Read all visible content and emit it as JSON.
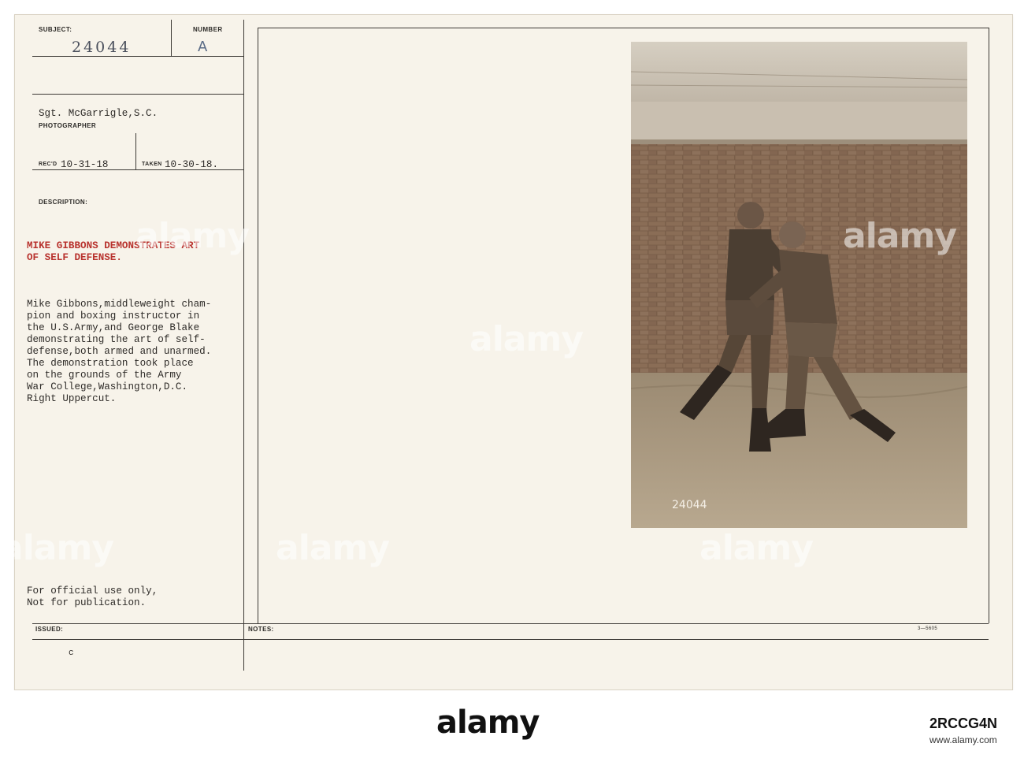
{
  "card": {
    "subject_label": "SUBJECT:",
    "number_label": "NUMBER",
    "subject_number": "24044",
    "number_value": "A",
    "photographer": "Sgt. McGarrigle,S.C.",
    "photographer_label": "PHOTOGRAPHER",
    "rec_label": "REC'D",
    "rec_date": "10-31-18",
    "taken_label": "TAKEN",
    "taken_date": "10-30-18.",
    "description_label": "DESCRIPTION:",
    "title_lines": [
      "MIKE GIBBONS DEMONSTRATES ART",
      "OF SELF DEFENSE."
    ],
    "body_lines": [
      "Mike Gibbons,middleweight cham-",
      "pion and boxing instructor in",
      "the U.S.Army,and George Blake",
      "demonstrating the art of self-",
      "defense,both armed and unarmed.",
      "The demonstration took place",
      "on the grounds of the Army",
      "War College,Washington,D.C.",
      "Right Uppercut."
    ],
    "restriction_lines": [
      "For official use only,",
      "Not for publication."
    ],
    "issued_label": "ISSUED:",
    "issued_value": "c",
    "notes_label": "NOTES:",
    "form_number": "3—5605"
  },
  "photo": {
    "negative_number": "24044",
    "description": "Two soldiers in uniform and boots sparring in front of a brick wall"
  },
  "watermark": {
    "text": "alamy",
    "image_id": "2RCCG4N",
    "url": "www.alamy.com"
  },
  "colors": {
    "card": "#f7f3ea",
    "red_type": "#b8322d",
    "ink": "#2e2b28",
    "photo_sepia": "#8e7d68"
  }
}
